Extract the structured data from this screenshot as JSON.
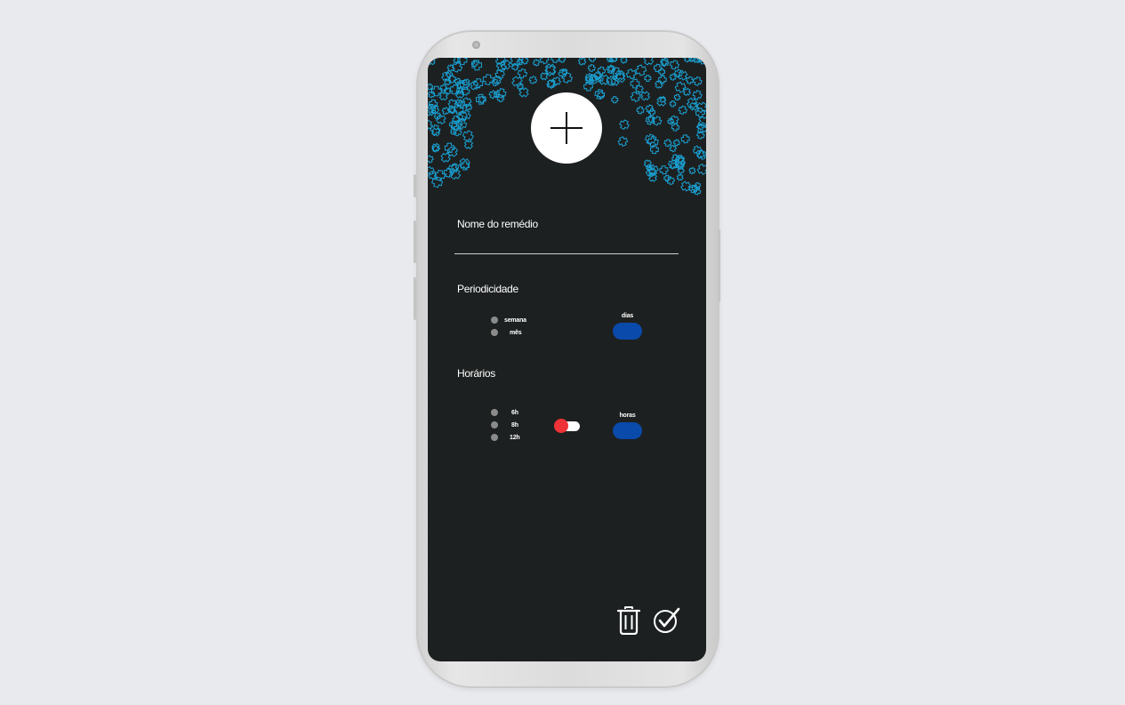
{
  "form": {
    "name_label": "Nome do remédio",
    "name_value": "",
    "periodicity_label": "Periodicidade",
    "periodicity_options": [
      "semana",
      "mês"
    ],
    "days_caption": "dias",
    "schedule_label": "Horários",
    "schedule_options": [
      "6h",
      "8h",
      "12h"
    ],
    "hours_caption": "horas"
  },
  "icons": {
    "add": "plus-icon",
    "delete": "trash-icon",
    "confirm": "check-circle-icon",
    "background": "plus-pattern"
  },
  "colors": {
    "screen_bg": "#1d2020",
    "accent_blue": "#0a4aab",
    "pattern_blue": "#1aa3d6",
    "toggle_red": "#ee3237",
    "radio_gray": "#8b8b8b"
  }
}
